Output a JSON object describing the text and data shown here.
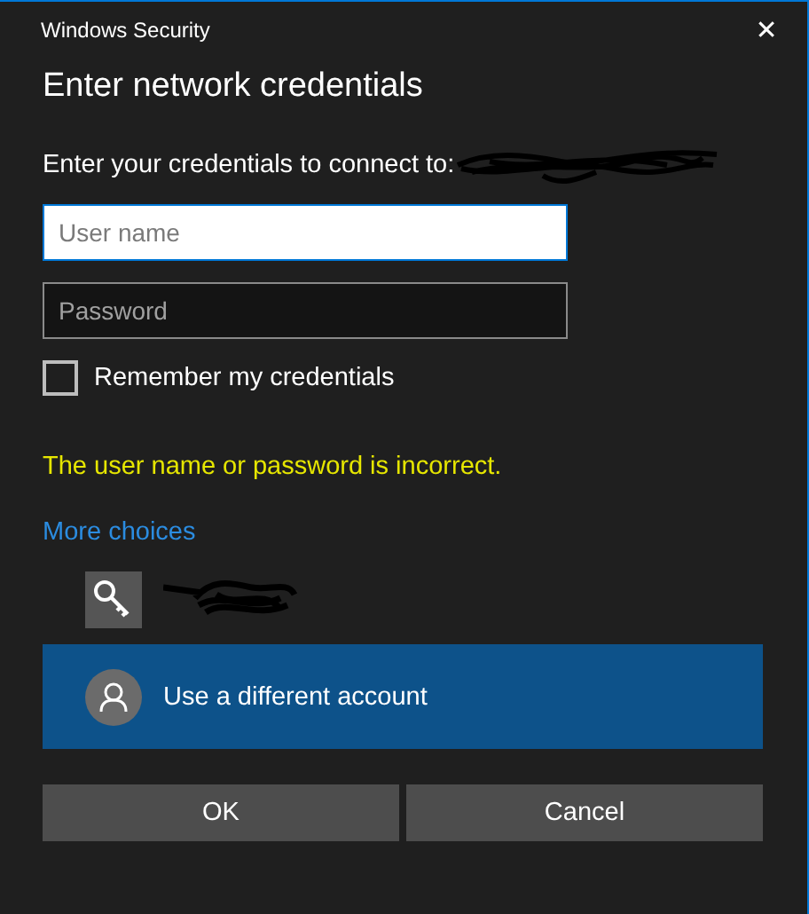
{
  "window": {
    "title": "Windows Security",
    "close": "✕"
  },
  "heading": "Enter network credentials",
  "prompt": "Enter your credentials to connect to:",
  "fields": [
    {
      "placeholder": "User name",
      "focused": true
    },
    {
      "placeholder": "Password",
      "focused": false
    }
  ],
  "remember": {
    "label": "Remember my credentials",
    "checked": false
  },
  "error": "The user name or password is incorrect.",
  "more_choices": "More choices",
  "accounts": [
    {
      "kind": "key",
      "selected": false
    },
    {
      "kind": "person",
      "label": "Use a different account",
      "selected": true
    }
  ],
  "buttons": [
    "OK",
    "Cancel"
  ]
}
